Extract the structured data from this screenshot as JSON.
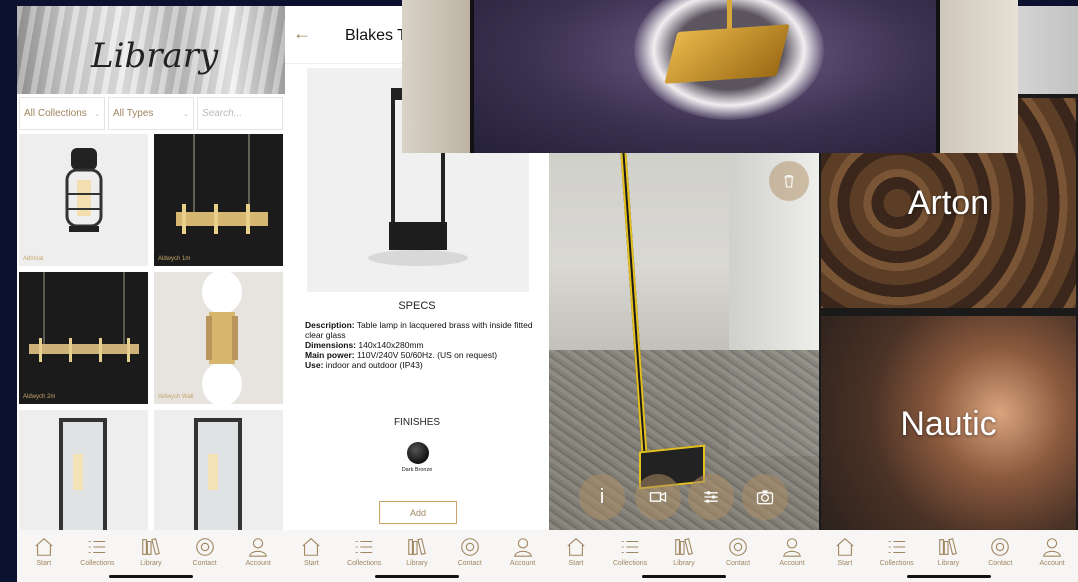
{
  "tabbar": {
    "items": [
      {
        "label": "Start",
        "icon": "home-icon"
      },
      {
        "label": "Collections",
        "icon": "list-icon"
      },
      {
        "label": "Library",
        "icon": "books-icon"
      },
      {
        "label": "Contact",
        "icon": "at-icon"
      },
      {
        "label": "Account",
        "icon": "user-icon"
      }
    ]
  },
  "library": {
    "title": "Library",
    "filters": {
      "collections": "All Collections",
      "types": "All Types",
      "search_placeholder": "Search..."
    },
    "products": [
      "Admiral",
      "Aldwych 1m",
      "Aldwych 2m",
      "Aldwych Wall",
      "",
      ""
    ]
  },
  "detail": {
    "title": "Blakes T",
    "specs_heading": "SPECS",
    "description_label": "Description:",
    "description": " Table lamp in lacquered brass with inside fitted clear glass",
    "dimensions_label": "Dimensions:",
    "dimensions": " 140x140x280mm",
    "power_label": "Main power:",
    "power": " 110V/240V 50/60Hz. (US on request)",
    "use_label": "Use:",
    "use": " indoor and outdoor (IP43)",
    "finishes_heading": "FINISHES",
    "finish_name": "Dark Bronze",
    "add_label": "Add"
  },
  "ar": {
    "info_label": "i"
  },
  "collections": {
    "items": [
      "Arton",
      "Nautic"
    ]
  },
  "colors": {
    "accent": "#a08660",
    "ar_highlight": "#e4c020",
    "background": "#0c1130"
  }
}
